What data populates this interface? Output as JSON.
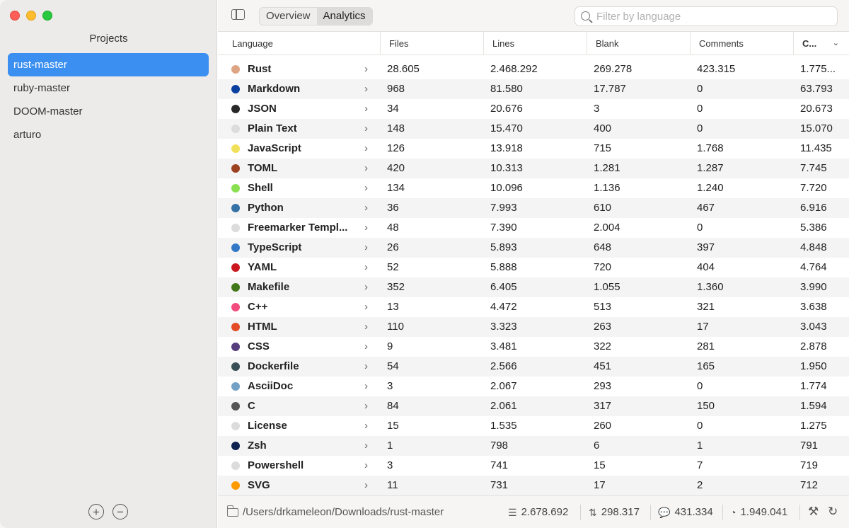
{
  "sidebar": {
    "title": "Projects",
    "projects": [
      "rust-master",
      "ruby-master",
      "DOOM-master",
      "arturo"
    ],
    "selected": 0
  },
  "toolbar": {
    "tabs": [
      "Overview",
      "Analytics"
    ],
    "active_tab": 1,
    "search_placeholder": "Filter by language"
  },
  "table": {
    "columns": [
      "Language",
      "Files",
      "Lines",
      "Blank",
      "Comments",
      "C..."
    ],
    "rows": [
      {
        "color": "#dea584",
        "language": "Rust",
        "files": "28.605",
        "lines": "2.468.292",
        "blank": "269.278",
        "comments": "423.315",
        "code": "1.775..."
      },
      {
        "color": "#083fa1",
        "language": "Markdown",
        "files": "968",
        "lines": "81.580",
        "blank": "17.787",
        "comments": "0",
        "code": "63.793"
      },
      {
        "color": "#292929",
        "language": "JSON",
        "files": "34",
        "lines": "20.676",
        "blank": "3",
        "comments": "0",
        "code": "20.673"
      },
      {
        "color": "#dcdcdc",
        "language": "Plain Text",
        "files": "148",
        "lines": "15.470",
        "blank": "400",
        "comments": "0",
        "code": "15.070"
      },
      {
        "color": "#f1e05a",
        "language": "JavaScript",
        "files": "126",
        "lines": "13.918",
        "blank": "715",
        "comments": "1.768",
        "code": "11.435"
      },
      {
        "color": "#9c4221",
        "language": "TOML",
        "files": "420",
        "lines": "10.313",
        "blank": "1.281",
        "comments": "1.287",
        "code": "7.745"
      },
      {
        "color": "#89e051",
        "language": "Shell",
        "files": "134",
        "lines": "10.096",
        "blank": "1.136",
        "comments": "1.240",
        "code": "7.720"
      },
      {
        "color": "#3572a5",
        "language": "Python",
        "files": "36",
        "lines": "7.993",
        "blank": "610",
        "comments": "467",
        "code": "6.916"
      },
      {
        "color": "#dcdcdc",
        "language": "Freemarker Templ...",
        "files": "48",
        "lines": "7.390",
        "blank": "2.004",
        "comments": "0",
        "code": "5.386"
      },
      {
        "color": "#3178c6",
        "language": "TypeScript",
        "files": "26",
        "lines": "5.893",
        "blank": "648",
        "comments": "397",
        "code": "4.848"
      },
      {
        "color": "#cb171e",
        "language": "YAML",
        "files": "52",
        "lines": "5.888",
        "blank": "720",
        "comments": "404",
        "code": "4.764"
      },
      {
        "color": "#427819",
        "language": "Makefile",
        "files": "352",
        "lines": "6.405",
        "blank": "1.055",
        "comments": "1.360",
        "code": "3.990"
      },
      {
        "color": "#f34b7d",
        "language": "C++",
        "files": "13",
        "lines": "4.472",
        "blank": "513",
        "comments": "321",
        "code": "3.638"
      },
      {
        "color": "#e34c26",
        "language": "HTML",
        "files": "110",
        "lines": "3.323",
        "blank": "263",
        "comments": "17",
        "code": "3.043"
      },
      {
        "color": "#563d7c",
        "language": "CSS",
        "files": "9",
        "lines": "3.481",
        "blank": "322",
        "comments": "281",
        "code": "2.878"
      },
      {
        "color": "#384d54",
        "language": "Dockerfile",
        "files": "54",
        "lines": "2.566",
        "blank": "451",
        "comments": "165",
        "code": "1.950"
      },
      {
        "color": "#73a0c5",
        "language": "AsciiDoc",
        "files": "3",
        "lines": "2.067",
        "blank": "293",
        "comments": "0",
        "code": "1.774"
      },
      {
        "color": "#555555",
        "language": "C",
        "files": "84",
        "lines": "2.061",
        "blank": "317",
        "comments": "150",
        "code": "1.594"
      },
      {
        "color": "#dcdcdc",
        "language": "License",
        "files": "15",
        "lines": "1.535",
        "blank": "260",
        "comments": "0",
        "code": "1.275"
      },
      {
        "color": "#0f2350",
        "language": "Zsh",
        "files": "1",
        "lines": "798",
        "blank": "6",
        "comments": "1",
        "code": "791"
      },
      {
        "color": "#dcdcdc",
        "language": "Powershell",
        "files": "3",
        "lines": "741",
        "blank": "15",
        "comments": "7",
        "code": "719"
      },
      {
        "color": "#ff9a00",
        "language": "SVG",
        "files": "11",
        "lines": "731",
        "blank": "17",
        "comments": "2",
        "code": "712"
      }
    ]
  },
  "status": {
    "path": "/Users/drkameleon/Downloads/rust-master",
    "total_lines": "2.678.692",
    "total_blank": "298.317",
    "total_comments": "431.334",
    "total_code": "1.949.041"
  }
}
